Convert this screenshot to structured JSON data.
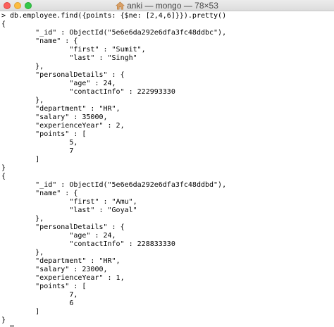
{
  "window": {
    "title": "anki — mongo — 78×53",
    "title_icon": "home-folder-icon"
  },
  "terminal": {
    "lines": [
      "> db.employee.find({points: {$ne: [2,4,6]}}).pretty()",
      "{",
      "        \"_id\" : ObjectId(\"5e6e6da292e6dfa3fc48ddbc\"),",
      "        \"name\" : {",
      "                \"first\" : \"Sumit\",",
      "                \"last\" : \"Singh\"",
      "        },",
      "        \"personalDetails\" : {",
      "                \"age\" : 24,",
      "                \"contactInfo\" : 222993330",
      "        },",
      "        \"department\" : \"HR\",",
      "        \"salary\" : 35000,",
      "        \"experienceYear\" : 2,",
      "        \"points\" : [",
      "                5,",
      "                7",
      "        ]",
      "}",
      "{",
      "        \"_id\" : ObjectId(\"5e6e6da292e6dfa3fc48ddbd\"),",
      "        \"name\" : {",
      "                \"first\" : \"Amu\",",
      "                \"last\" : \"Goyal\"",
      "        },",
      "        \"personalDetails\" : {",
      "                \"age\" : 24,",
      "                \"contactInfo\" : 228833330",
      "        },",
      "        \"department\" : \"HR\",",
      "        \"salary\" : 23000,",
      "        \"experienceYear\" : 1,",
      "        \"points\" : [",
      "                7,",
      "                6",
      "        ]",
      "}",
      "> "
    ]
  }
}
